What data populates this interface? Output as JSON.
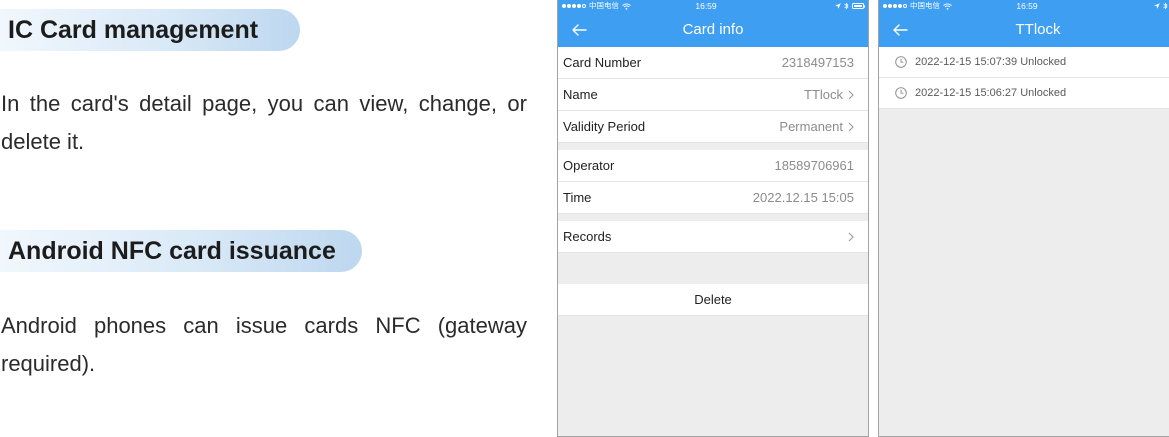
{
  "sections": [
    {
      "heading": "IC Card management",
      "lines": [
        "In the card's detail page, you can view, change, or",
        "delete it."
      ]
    },
    {
      "heading": "Android NFC card issuance",
      "lines": [
        "Android phones can issue cards NFC (gateway",
        "required)."
      ]
    }
  ],
  "status_bar": {
    "carrier": "中国电信",
    "time": "16:59",
    "signal_strength": 4,
    "signal_max": 5,
    "battery_level": 1
  },
  "card_info": {
    "title": "Card info",
    "details": [
      {
        "label": "Card Number",
        "value": "2318497153"
      },
      {
        "label": "Name",
        "value": "TTlock"
      },
      {
        "label": "Validity Period",
        "value": "Permanent"
      }
    ],
    "operation": [
      {
        "label": "Operator",
        "value": "18589706961"
      },
      {
        "label": "Time",
        "value": "2022.12.15 15:05"
      }
    ],
    "records_label": "Records",
    "delete_label": "Delete"
  },
  "records_screen": {
    "title": "TTlock",
    "entries": [
      "2022-12-15 15:07:39 Unlocked",
      "2022-12-15 15:06:27 Unlocked"
    ]
  },
  "colors": {
    "nav_blue": "#3d9ef2",
    "banner_start": "#f1f7fd",
    "banner_end": "#bdd7ef",
    "background_gray": "#ededed"
  },
  "icons": {
    "back": "arrow-left-icon",
    "disclosure": "chevron-right-icon",
    "record": "clock-icon",
    "signal": "signal-dots-icon",
    "wifi": "wifi-icon",
    "location": "location-arrow-icon",
    "bluetooth": "bluetooth-icon",
    "battery": "battery-icon"
  }
}
